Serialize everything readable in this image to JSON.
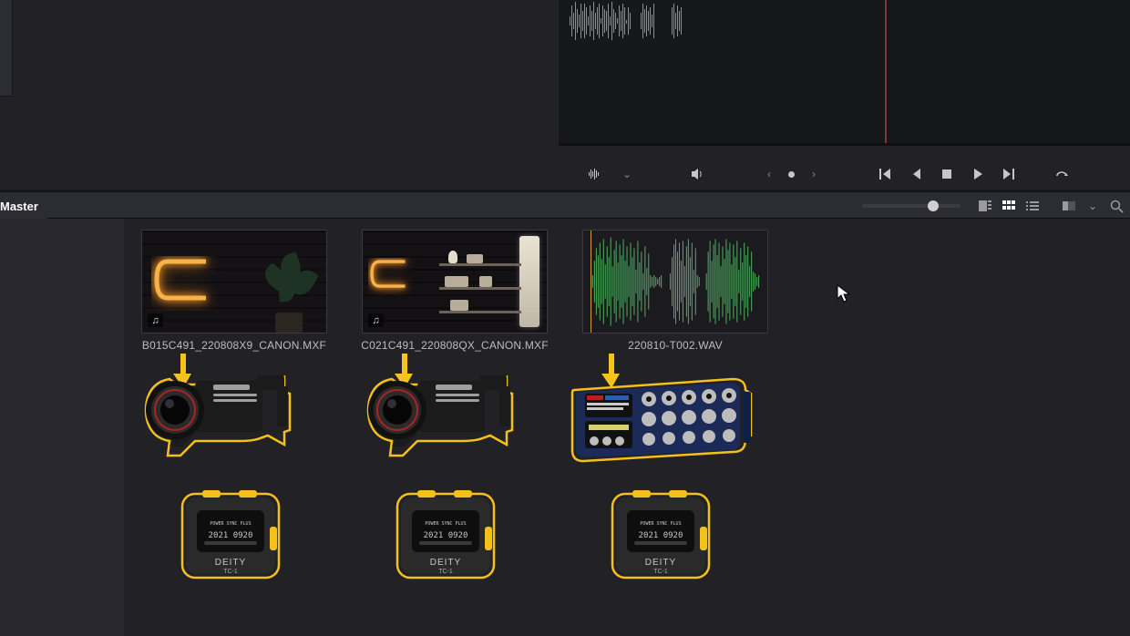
{
  "bin": {
    "label": "Master"
  },
  "clips": [
    {
      "filename": "B015C491_220808X9_CANON.MXF"
    },
    {
      "filename": "C021C491_220808QX_CANON.MXF"
    },
    {
      "filename": "220810-T002.WAV"
    }
  ],
  "tc_device": {
    "brand": "DEITY",
    "model": "TC-1",
    "display": "2021 0920"
  }
}
